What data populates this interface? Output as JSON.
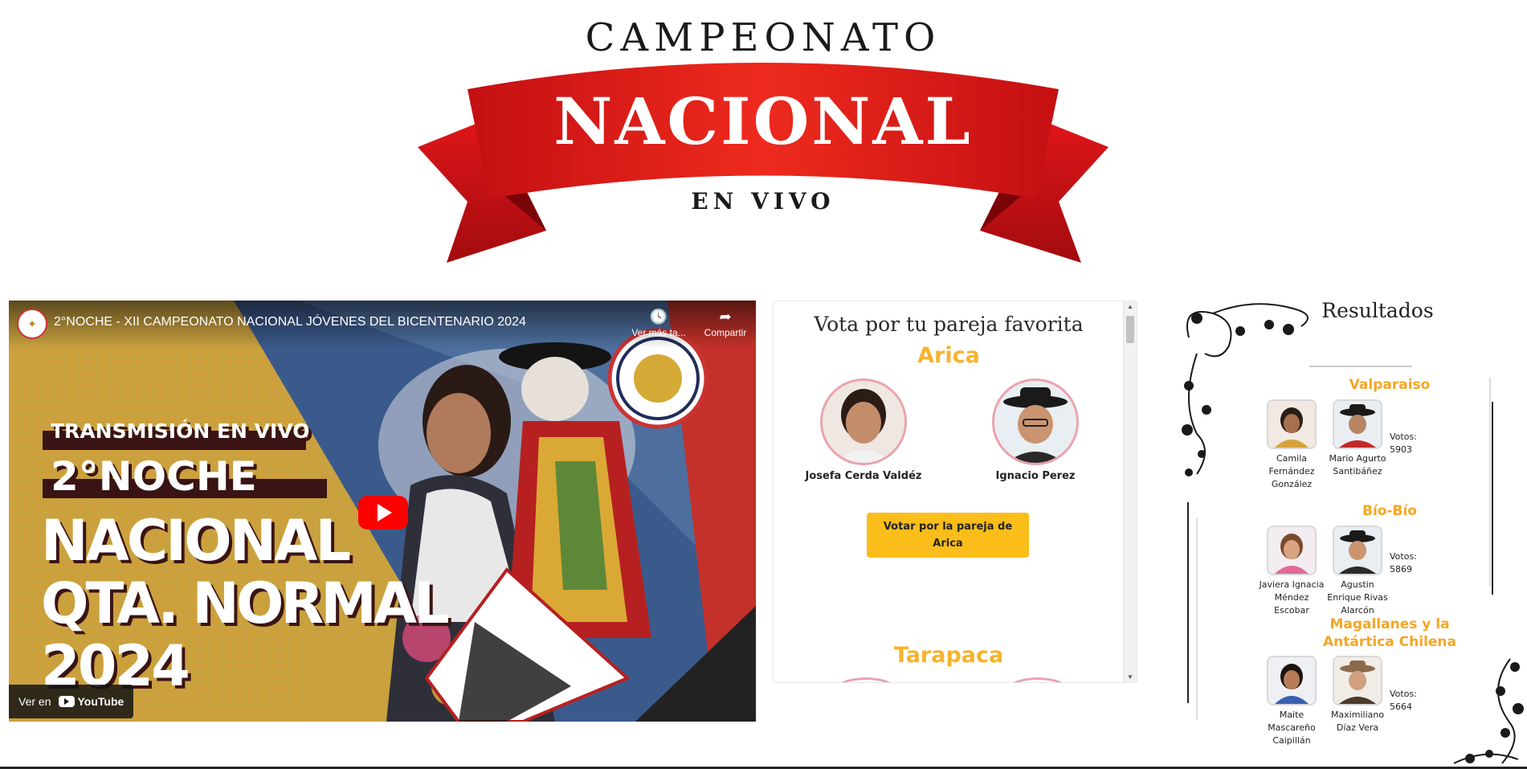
{
  "logo": {
    "top": "CAMPEONATO",
    "main": "NACIONAL",
    "bottom": "EN VIVO"
  },
  "video": {
    "title": "2°NOCHE - XII CAMPEONATO NACIONAL JÓVENES DEL BICENTENARIO 2024",
    "watch_later": "Ver más ta...",
    "share": "Compartir",
    "watch_on": "Ver en",
    "youtube": "YouTube",
    "poster": {
      "line1": "TRANSMISIÓN EN VIVO",
      "line2": "2°NOCHE",
      "line3": "NACIONAL",
      "line4": "QTA. NORMAL",
      "line5": "2024"
    }
  },
  "vote": {
    "heading": "Vota por tu pareja favorita",
    "regions": [
      {
        "name": "Arica",
        "woman": "Josefa Cerda Valdéz",
        "man": "Ignacio Perez",
        "button": "Votar por la pareja de Arica"
      },
      {
        "name": "Tarapaca"
      }
    ]
  },
  "results": {
    "title": "Resultados",
    "votes_label": "Votos:",
    "items": [
      {
        "region": "Valparaiso",
        "woman": "Camila Fernández González",
        "man": "Mario Agurto Santibáñez",
        "votes": "5903"
      },
      {
        "region": "Bío-Bío",
        "woman": "Javiera Ignacia Méndez Escobar",
        "man": "Agustin Enrique Rivas Alarcón",
        "votes": "5869"
      },
      {
        "region": "Magallanes y la Antártica Chilena",
        "woman": "Maite Mascareño Caipillán",
        "man": "Maximiliano Díaz Vera",
        "votes": "5664"
      }
    ]
  },
  "colors": {
    "accent": "#f7b32b",
    "ribbon": "#e21b1b",
    "button": "#fbbd1a",
    "youtube_red": "#ff0000"
  }
}
